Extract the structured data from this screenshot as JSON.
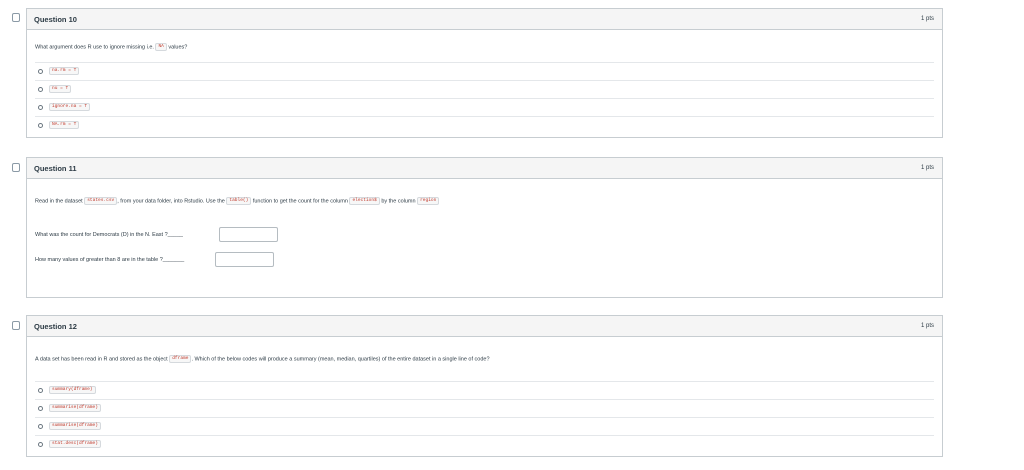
{
  "questions": [
    {
      "title": "Question 10",
      "points": "1 pts",
      "text_before": "What argument does R use to ignore missing i.e.",
      "code": "NA",
      "text_after": "values?",
      "answers": [
        "na.rm = T",
        "nu = T",
        "ignore.na = T",
        "NA.rm = T"
      ]
    },
    {
      "title": "Question 11",
      "points": "1 pts",
      "text_1": "Read in the dataset",
      "code_1": "states.csv",
      "text_2": ", from your data folder, into Rstudio. Use the",
      "code_2": "table()",
      "text_3": "function to get the count for the column",
      "code_3": "election$",
      "text_4": "by the column",
      "code_4": "region",
      "sub1": "What was the count for Democrats (D) in the N. East ?_____",
      "sub2": "How many values of greater than 8 are in the table ?_______"
    },
    {
      "title": "Question 12",
      "points": "1 pts",
      "text_before": "A data set has been read in R and stored as the object",
      "code": "dframe",
      "text_after": ". Which of the below codes will produce a summary (mean, median, quartiles) of the entire dataset in a single line of code?",
      "answers": [
        "summary(dframe)",
        "summarise(dframe)",
        "summarise(dframe)",
        "stat.desc(dframe)"
      ]
    }
  ]
}
